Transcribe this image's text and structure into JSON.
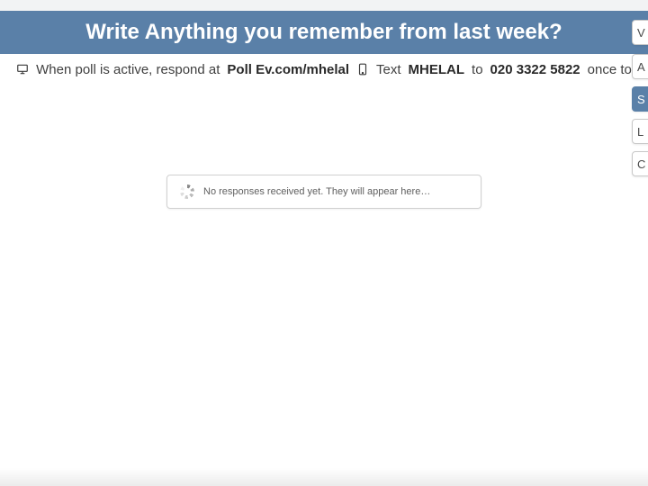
{
  "colors": {
    "banner_bg": "#5a80a8",
    "banner_text": "#ffffff"
  },
  "title": "Write Anything you remember from last week?",
  "instructions": {
    "prefix": "When poll is active, respond at ",
    "url": "Poll Ev.com/mhelal",
    "text_prefix": "Text ",
    "code": "MHELAL",
    "to": " to ",
    "phone": "020 3322 5822",
    "suffix": " once to"
  },
  "no_responses": "No responses received yet. They will appear here…",
  "side_buttons": [
    "V",
    "A",
    "S",
    "L",
    "C"
  ]
}
